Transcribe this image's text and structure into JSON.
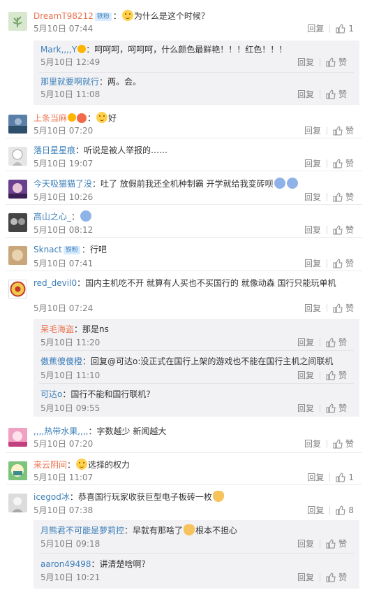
{
  "labels": {
    "reply": "回复",
    "like": "赞"
  },
  "comments": [
    {
      "user": "DreamT98212",
      "badge": "铁粉",
      "text": "为什么是这个时候？",
      "emoji_prefix": "face",
      "date": "5月10日 07:44",
      "likes": "1"
    },
    {
      "user": "上条当麻",
      "text": "好",
      "emoji_prefix": "face",
      "date": "5月10日 07:20",
      "likes": "赞"
    },
    {
      "user": "落日星星痕",
      "text": "听说是被人举报的……",
      "date": "5月10日 19:07",
      "likes": "赞"
    },
    {
      "user": "今天吸猫猫了没",
      "text": "吐了  放假前我还全机种制霸 开学就给我变砖呗",
      "date": "5月10日 10:26",
      "likes": "赞"
    },
    {
      "user": "高山之心_",
      "text": "",
      "date": "5月10日 08:12",
      "likes": "赞"
    },
    {
      "user": "Sknact",
      "badge": "铁粉",
      "text": "行吧",
      "date": "5月10日 07:41",
      "likes": "赞"
    },
    {
      "user": "red_devil0",
      "text": "国内主机吃不开      就算有人买也不买国行的       就像动森    国行只能玩单机",
      "date": "5月10日 07:24",
      "likes": "赞"
    },
    {
      "user": ",,,,热带水果,,,,",
      "text": "字数越少     新闻越大",
      "date": "5月10日 07:20",
      "likes": "赞"
    },
    {
      "user": "来云阴间",
      "text": "选择的权力",
      "date": "5月10日 11:07",
      "likes": "1"
    },
    {
      "user": "icegod冰",
      "text": "恭喜国行玩家收获巨型电子板砖一枚",
      "date": "5月10日 07:38",
      "likes": "8"
    }
  ],
  "replies": [
    {
      "user": "Mark,,,,Y",
      "text": "呵呵呵，呵呵呵，什么颜色最鲜艳！！！红色！！！",
      "date": "5月10日 12:49",
      "likes": "赞"
    },
    {
      "user": "那里就要啊就行",
      "text": "两。会。",
      "date": "5月10日 11:08",
      "likes": "赞"
    },
    {
      "user": "呆毛海盗",
      "text": "那是ns",
      "date": "5月10日 11:20",
      "likes": "赞"
    },
    {
      "user": "傲蕉傻傻橙",
      "text": "回复@可达o:没正式在国行上架的游戏也不能在国行主机之间联机",
      "date": "5月10日 11:10",
      "likes": "赞"
    },
    {
      "user": "可达o",
      "text": "国行不能和国行联机？",
      "date": "5月10日 09:55",
      "likes": "赞"
    },
    {
      "user": "月熊君不可能是萝莉控",
      "text": "早就有那啥了",
      "text2": "根本不担心",
      "date": "5月10日 09:18",
      "likes": "赞"
    },
    {
      "user": "aaron49498",
      "text": "讲清楚啥啊？",
      "date": "5月10日 10:21",
      "likes": "赞"
    }
  ],
  "colors": {
    "username": "#eb7350",
    "reply_username": "#3c7fb9",
    "meta": "#808080",
    "reply_bg": "#f2f2f5"
  }
}
